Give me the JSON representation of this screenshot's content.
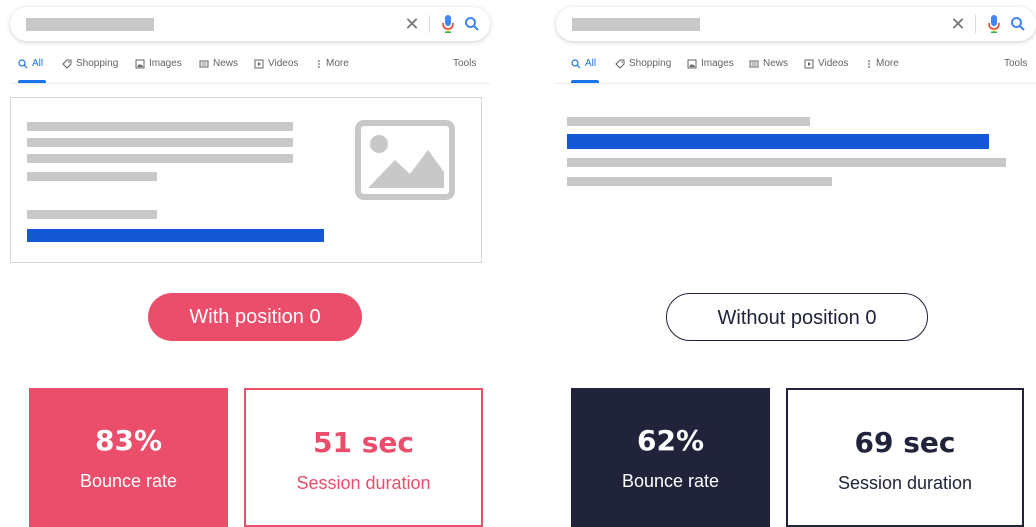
{
  "colors": {
    "accent_pink": "#ea4e6a",
    "navy": "#20233a",
    "google_blue": "#1a73e8",
    "link_blue": "#1558d6",
    "placeholder_gray": "#c8c8c8"
  },
  "search_tabs": [
    {
      "label": "All",
      "icon": "search-icon"
    },
    {
      "label": "Shopping",
      "icon": "tag-icon"
    },
    {
      "label": "Images",
      "icon": "image-icon"
    },
    {
      "label": "News",
      "icon": "newspaper-icon"
    },
    {
      "label": "Videos",
      "icon": "play-icon"
    },
    {
      "label": "More",
      "icon": "more-vert-icon"
    }
  ],
  "tools_label": "Tools",
  "left": {
    "pill_label": "With position 0",
    "bounce_value": "83%",
    "bounce_label": "Bounce rate",
    "session_value": "51 sec",
    "session_label": "Session duration"
  },
  "right": {
    "pill_label": "Without position 0",
    "bounce_value": "62%",
    "bounce_label": "Bounce rate",
    "session_value": "69 sec",
    "session_label": "Session duration"
  }
}
